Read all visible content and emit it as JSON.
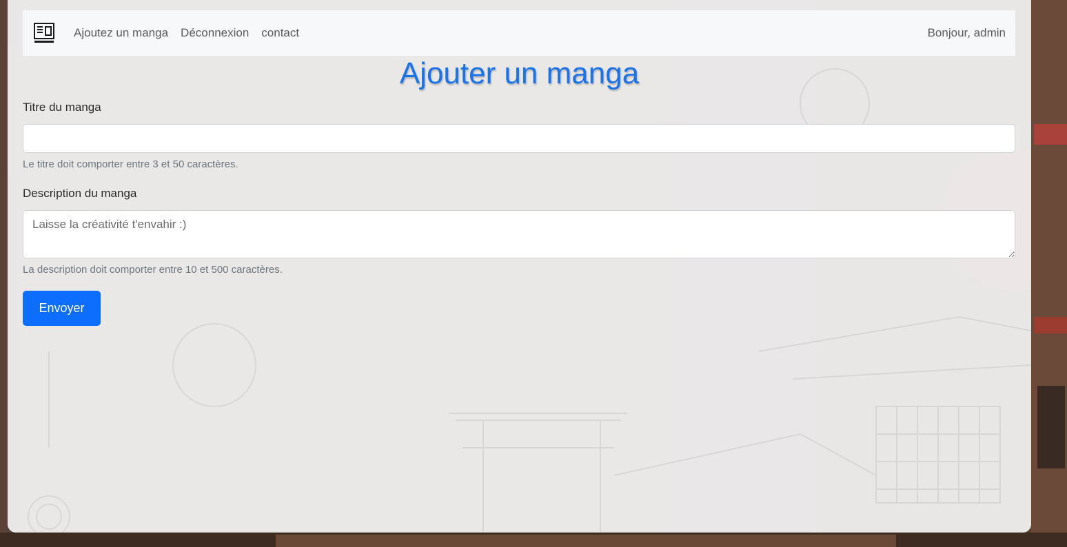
{
  "navbar": {
    "logo_icon": "manga-verse-logo-icon",
    "links": [
      {
        "label": "Ajoutez un manga"
      },
      {
        "label": "Déconnexion"
      },
      {
        "label": "contact"
      }
    ],
    "greeting": "Bonjour, admin"
  },
  "page": {
    "title": "Ajouter un manga"
  },
  "form": {
    "title_field": {
      "label": "Titre du manga",
      "value": "",
      "placeholder": "",
      "help": "Le titre doit comporter entre 3 et 50 caractères."
    },
    "description_field": {
      "label": "Description du manga",
      "value": "",
      "placeholder": "Laisse la créativité t'envahir :)",
      "help": "La description doit comporter entre 10 et 500 caractères."
    },
    "submit_label": "Envoyer"
  },
  "colors": {
    "title": "#1a73e8",
    "primary_button": "#0d6efd",
    "navbar_bg": "#f7f8f9"
  }
}
